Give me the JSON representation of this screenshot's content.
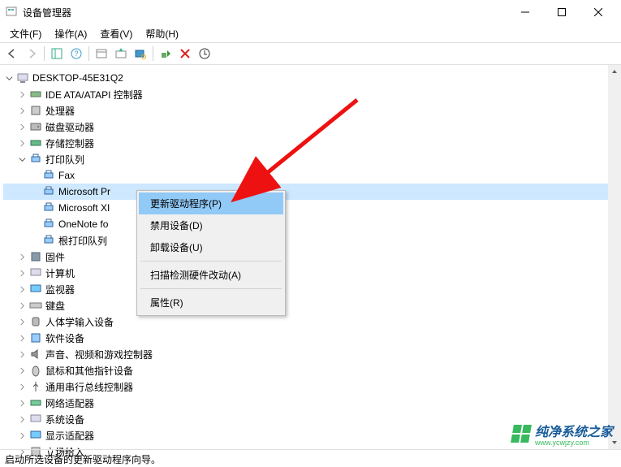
{
  "window": {
    "title": "设备管理器"
  },
  "menu": {
    "file": "文件(F)",
    "action": "操作(A)",
    "view": "查看(V)",
    "help": "帮助(H)"
  },
  "root": "DESKTOP-45E31Q2",
  "categories": [
    "IDE ATA/ATAPI 控制器",
    "处理器",
    "磁盘驱动器",
    "存储控制器",
    "打印队列",
    "固件",
    "计算机",
    "监视器",
    "键盘",
    "人体学输入设备",
    "软件设备",
    "声音、视频和游戏控制器",
    "鼠标和其他指针设备",
    "通用串行总线控制器",
    "网络适配器",
    "系统设备",
    "显示适配器"
  ],
  "printers": [
    "Fax",
    "Microsoft Pr",
    "Microsoft XI",
    "OneNote fo",
    "根打印队列"
  ],
  "last_truncated": "立场给入",
  "ctx": {
    "update": "更新驱动程序(P)",
    "disable": "禁用设备(D)",
    "uninstall": "卸载设备(U)",
    "scan": "扫描检测硬件改动(A)",
    "props": "属性(R)"
  },
  "status": "启动所选设备的更新驱动程序向导。",
  "watermark": {
    "cn": "纯净系统之家",
    "url": "www.ycwjzy.com"
  }
}
